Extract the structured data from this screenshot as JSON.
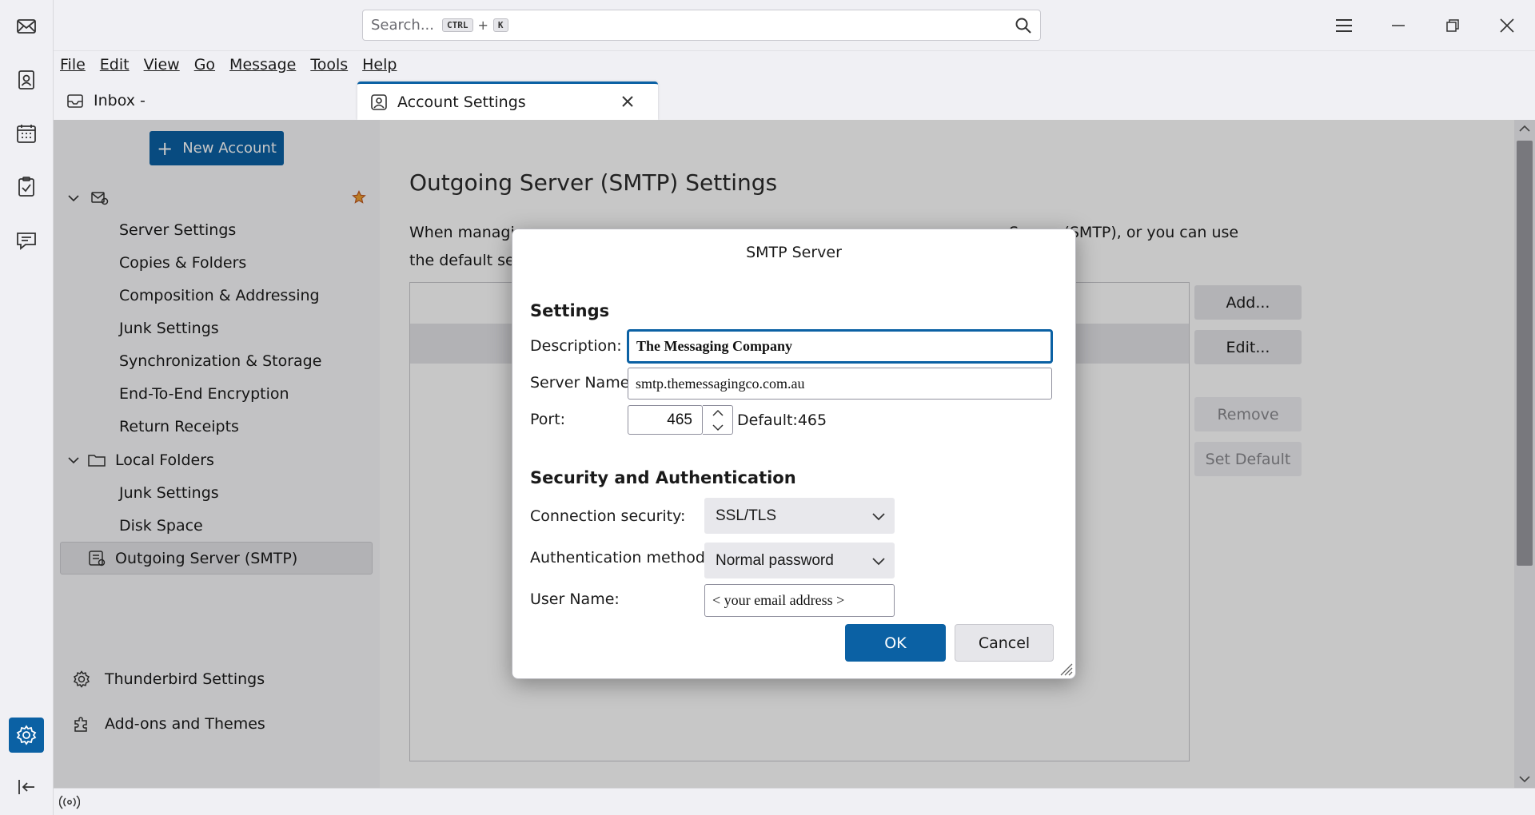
{
  "search": {
    "placeholder": "Search...",
    "kbd_ctrl": "CTRL",
    "kbd_plus": "+",
    "kbd_key": "K"
  },
  "menu": [
    "File",
    "Edit",
    "View",
    "Go",
    "Message",
    "Tools",
    "Help"
  ],
  "tabs": {
    "inbox": "Inbox -",
    "account": "Account Settings"
  },
  "sidebar": {
    "new_account": "New Account",
    "account_items": [
      "Server Settings",
      "Copies & Folders",
      "Composition & Addressing",
      "Junk Settings",
      "Synchronization & Storage",
      "End-To-End Encryption",
      "Return Receipts"
    ],
    "local_folders": "Local Folders",
    "local_items": [
      "Junk Settings",
      "Disk Space"
    ],
    "outgoing": "Outgoing Server (SMTP)",
    "thunderbird_settings": "Thunderbird Settings",
    "addons": "Add-ons and Themes"
  },
  "main": {
    "title": "Outgoing Server (SMTP) Settings",
    "desc_line1_a": "When managin",
    "desc_line1_b": "g Server (SMTP), or you can use",
    "desc_line2": "the default ser",
    "buttons": {
      "add": "Add...",
      "edit": "Edit...",
      "remove": "Remove",
      "set_default": "Set Default"
    }
  },
  "dialog": {
    "title": "SMTP Server",
    "settings_heading": "Settings",
    "description_label": "Description:",
    "description_value": "The Messaging Company",
    "server_label": "Server Name:",
    "server_value": "smtp.themessagingco.com.au",
    "port_label": "Port:",
    "port_value": "465",
    "port_default": "Default:465",
    "security_heading": "Security and Authentication",
    "conn_label": "Connection security:",
    "conn_value": "SSL/TLS",
    "auth_label": "Authentication method:",
    "auth_value": "Normal password",
    "user_label": "User Name:",
    "user_value": "< your email address >",
    "ok": "OK",
    "cancel": "Cancel"
  }
}
